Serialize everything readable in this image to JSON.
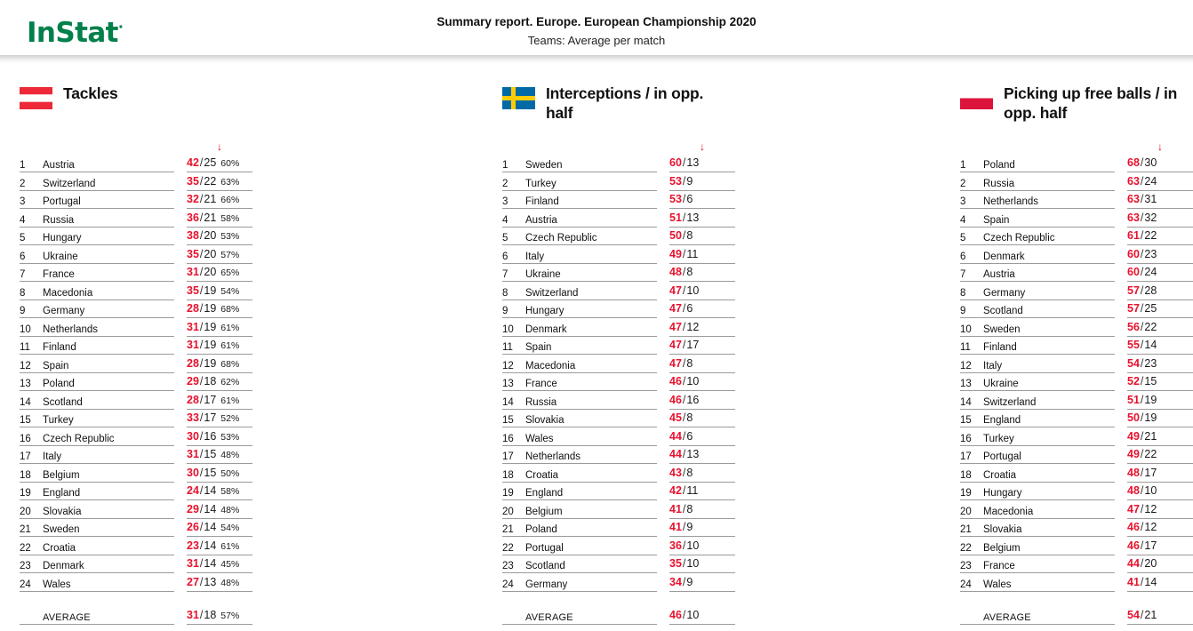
{
  "brand": {
    "name": "InStat",
    "dot": "·",
    "color": "#00804A"
  },
  "header": {
    "title": "Summary report. Europe. European Championship 2020",
    "subtitle": "Teams: Average per match"
  },
  "table_common": {
    "sort_arrow": "↓",
    "average_label": "AVERAGE",
    "separator": "/"
  },
  "panels": [
    {
      "id": "tackles",
      "title": "Tackles",
      "flag": "austria-flag",
      "flag_colors": [
        "#ED2939",
        "#FFFFFF",
        "#ED2939"
      ],
      "has_percent": true,
      "rows": [
        {
          "rank": "1",
          "team": "Austria",
          "v1": "42",
          "v2": "25",
          "pct": "60%"
        },
        {
          "rank": "2",
          "team": "Switzerland",
          "v1": "35",
          "v2": "22",
          "pct": "63%"
        },
        {
          "rank": "3",
          "team": "Portugal",
          "v1": "32",
          "v2": "21",
          "pct": "66%"
        },
        {
          "rank": "4",
          "team": "Russia",
          "v1": "36",
          "v2": "21",
          "pct": "58%"
        },
        {
          "rank": "5",
          "team": "Hungary",
          "v1": "38",
          "v2": "20",
          "pct": "53%"
        },
        {
          "rank": "6",
          "team": "Ukraine",
          "v1": "35",
          "v2": "20",
          "pct": "57%"
        },
        {
          "rank": "7",
          "team": "France",
          "v1": "31",
          "v2": "20",
          "pct": "65%"
        },
        {
          "rank": "8",
          "team": "Macedonia",
          "v1": "35",
          "v2": "19",
          "pct": "54%"
        },
        {
          "rank": "9",
          "team": "Germany",
          "v1": "28",
          "v2": "19",
          "pct": "68%"
        },
        {
          "rank": "10",
          "team": "Netherlands",
          "v1": "31",
          "v2": "19",
          "pct": "61%"
        },
        {
          "rank": "11",
          "team": "Finland",
          "v1": "31",
          "v2": "19",
          "pct": "61%"
        },
        {
          "rank": "12",
          "team": "Spain",
          "v1": "28",
          "v2": "19",
          "pct": "68%"
        },
        {
          "rank": "13",
          "team": "Poland",
          "v1": "29",
          "v2": "18",
          "pct": "62%"
        },
        {
          "rank": "14",
          "team": "Scotland",
          "v1": "28",
          "v2": "17",
          "pct": "61%"
        },
        {
          "rank": "15",
          "team": "Turkey",
          "v1": "33",
          "v2": "17",
          "pct": "52%"
        },
        {
          "rank": "16",
          "team": "Czech Republic",
          "v1": "30",
          "v2": "16",
          "pct": "53%"
        },
        {
          "rank": "17",
          "team": "Italy",
          "v1": "31",
          "v2": "15",
          "pct": "48%"
        },
        {
          "rank": "18",
          "team": "Belgium",
          "v1": "30",
          "v2": "15",
          "pct": "50%"
        },
        {
          "rank": "19",
          "team": "England",
          "v1": "24",
          "v2": "14",
          "pct": "58%"
        },
        {
          "rank": "20",
          "team": "Slovakia",
          "v1": "29",
          "v2": "14",
          "pct": "48%"
        },
        {
          "rank": "21",
          "team": "Sweden",
          "v1": "26",
          "v2": "14",
          "pct": "54%"
        },
        {
          "rank": "22",
          "team": "Croatia",
          "v1": "23",
          "v2": "14",
          "pct": "61%"
        },
        {
          "rank": "23",
          "team": "Denmark",
          "v1": "31",
          "v2": "14",
          "pct": "45%"
        },
        {
          "rank": "24",
          "team": "Wales",
          "v1": "27",
          "v2": "13",
          "pct": "48%"
        }
      ],
      "average": {
        "v1": "31",
        "v2": "18",
        "pct": "57%"
      }
    },
    {
      "id": "interceptions",
      "title": "Interceptions / in opp. half",
      "flag": "sweden-flag",
      "flag_colors": [
        "#006AA7",
        "#FECC00"
      ],
      "has_percent": false,
      "rows": [
        {
          "rank": "1",
          "team": "Sweden",
          "v1": "60",
          "v2": "13",
          "pct": ""
        },
        {
          "rank": "2",
          "team": "Turkey",
          "v1": "53",
          "v2": "9",
          "pct": ""
        },
        {
          "rank": "3",
          "team": "Finland",
          "v1": "53",
          "v2": "6",
          "pct": ""
        },
        {
          "rank": "4",
          "team": "Austria",
          "v1": "51",
          "v2": "13",
          "pct": ""
        },
        {
          "rank": "5",
          "team": "Czech Republic",
          "v1": "50",
          "v2": "8",
          "pct": ""
        },
        {
          "rank": "6",
          "team": "Italy",
          "v1": "49",
          "v2": "11",
          "pct": ""
        },
        {
          "rank": "7",
          "team": "Ukraine",
          "v1": "48",
          "v2": "8",
          "pct": ""
        },
        {
          "rank": "8",
          "team": "Switzerland",
          "v1": "47",
          "v2": "10",
          "pct": ""
        },
        {
          "rank": "9",
          "team": "Hungary",
          "v1": "47",
          "v2": "6",
          "pct": ""
        },
        {
          "rank": "10",
          "team": "Denmark",
          "v1": "47",
          "v2": "12",
          "pct": ""
        },
        {
          "rank": "11",
          "team": "Spain",
          "v1": "47",
          "v2": "17",
          "pct": ""
        },
        {
          "rank": "12",
          "team": "Macedonia",
          "v1": "47",
          "v2": "8",
          "pct": ""
        },
        {
          "rank": "13",
          "team": "France",
          "v1": "46",
          "v2": "10",
          "pct": ""
        },
        {
          "rank": "14",
          "team": "Russia",
          "v1": "46",
          "v2": "16",
          "pct": ""
        },
        {
          "rank": "15",
          "team": "Slovakia",
          "v1": "45",
          "v2": "8",
          "pct": ""
        },
        {
          "rank": "16",
          "team": "Wales",
          "v1": "44",
          "v2": "6",
          "pct": ""
        },
        {
          "rank": "17",
          "team": "Netherlands",
          "v1": "44",
          "v2": "13",
          "pct": ""
        },
        {
          "rank": "18",
          "team": "Croatia",
          "v1": "43",
          "v2": "8",
          "pct": ""
        },
        {
          "rank": "19",
          "team": "England",
          "v1": "42",
          "v2": "11",
          "pct": ""
        },
        {
          "rank": "20",
          "team": "Belgium",
          "v1": "41",
          "v2": "8",
          "pct": ""
        },
        {
          "rank": "21",
          "team": "Poland",
          "v1": "41",
          "v2": "9",
          "pct": ""
        },
        {
          "rank": "22",
          "team": "Portugal",
          "v1": "36",
          "v2": "10",
          "pct": ""
        },
        {
          "rank": "23",
          "team": "Scotland",
          "v1": "35",
          "v2": "10",
          "pct": ""
        },
        {
          "rank": "24",
          "team": "Germany",
          "v1": "34",
          "v2": "9",
          "pct": ""
        }
      ],
      "average": {
        "v1": "46",
        "v2": "10",
        "pct": ""
      }
    },
    {
      "id": "picking-up-free-balls",
      "title": "Picking up free balls / in opp. half",
      "flag": "poland-flag",
      "flag_colors": [
        "#FFFFFF",
        "#DC143C"
      ],
      "has_percent": false,
      "rows": [
        {
          "rank": "1",
          "team": "Poland",
          "v1": "68",
          "v2": "30",
          "pct": ""
        },
        {
          "rank": "2",
          "team": "Russia",
          "v1": "63",
          "v2": "24",
          "pct": ""
        },
        {
          "rank": "3",
          "team": "Netherlands",
          "v1": "63",
          "v2": "31",
          "pct": ""
        },
        {
          "rank": "4",
          "team": "Spain",
          "v1": "63",
          "v2": "32",
          "pct": ""
        },
        {
          "rank": "5",
          "team": "Czech Republic",
          "v1": "61",
          "v2": "22",
          "pct": ""
        },
        {
          "rank": "6",
          "team": "Denmark",
          "v1": "60",
          "v2": "23",
          "pct": ""
        },
        {
          "rank": "7",
          "team": "Austria",
          "v1": "60",
          "v2": "24",
          "pct": ""
        },
        {
          "rank": "8",
          "team": "Germany",
          "v1": "57",
          "v2": "28",
          "pct": ""
        },
        {
          "rank": "9",
          "team": "Scotland",
          "v1": "57",
          "v2": "25",
          "pct": ""
        },
        {
          "rank": "10",
          "team": "Sweden",
          "v1": "56",
          "v2": "22",
          "pct": ""
        },
        {
          "rank": "11",
          "team": "Finland",
          "v1": "55",
          "v2": "14",
          "pct": ""
        },
        {
          "rank": "12",
          "team": "Italy",
          "v1": "54",
          "v2": "23",
          "pct": ""
        },
        {
          "rank": "13",
          "team": "Ukraine",
          "v1": "52",
          "v2": "15",
          "pct": ""
        },
        {
          "rank": "14",
          "team": "Switzerland",
          "v1": "51",
          "v2": "19",
          "pct": ""
        },
        {
          "rank": "15",
          "team": "England",
          "v1": "50",
          "v2": "19",
          "pct": ""
        },
        {
          "rank": "16",
          "team": "Turkey",
          "v1": "49",
          "v2": "21",
          "pct": ""
        },
        {
          "rank": "17",
          "team": "Portugal",
          "v1": "49",
          "v2": "22",
          "pct": ""
        },
        {
          "rank": "18",
          "team": "Croatia",
          "v1": "48",
          "v2": "17",
          "pct": ""
        },
        {
          "rank": "19",
          "team": "Hungary",
          "v1": "48",
          "v2": "10",
          "pct": ""
        },
        {
          "rank": "20",
          "team": "Macedonia",
          "v1": "47",
          "v2": "12",
          "pct": ""
        },
        {
          "rank": "21",
          "team": "Slovakia",
          "v1": "46",
          "v2": "12",
          "pct": ""
        },
        {
          "rank": "22",
          "team": "Belgium",
          "v1": "46",
          "v2": "17",
          "pct": ""
        },
        {
          "rank": "23",
          "team": "France",
          "v1": "44",
          "v2": "20",
          "pct": ""
        },
        {
          "rank": "24",
          "team": "Wales",
          "v1": "41",
          "v2": "14",
          "pct": ""
        }
      ],
      "average": {
        "v1": "54",
        "v2": "21",
        "pct": ""
      }
    }
  ]
}
